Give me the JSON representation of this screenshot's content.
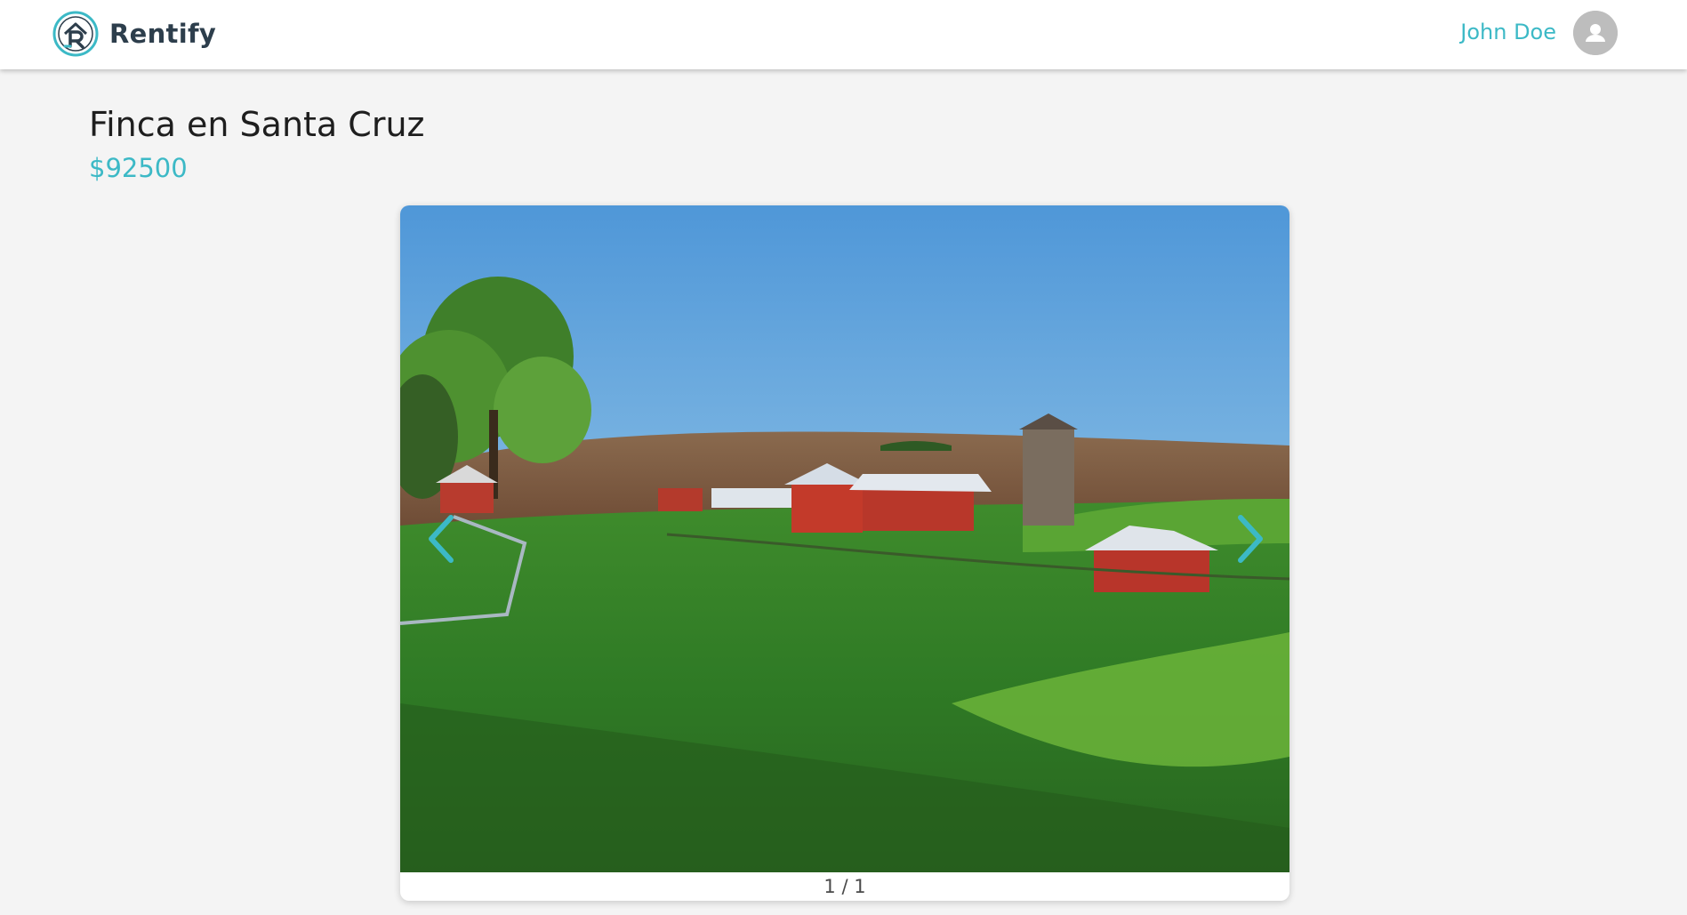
{
  "navbar": {
    "brand": "Rentify",
    "user_name": "John Doe"
  },
  "listing": {
    "title": "Finca en Santa Cruz",
    "price": "$92500"
  },
  "carousel": {
    "counter": "1 / 1",
    "image_alt": "Farm with red barns, silo and green pasture"
  },
  "colors": {
    "accent": "#3cb9c6",
    "brand_dark": "#2d3e4c",
    "background": "#f4f4f4"
  },
  "icons": {
    "logo": "rentify-logo-icon",
    "avatar": "user-avatar-icon",
    "prev": "chevron-left-icon",
    "next": "chevron-right-icon"
  }
}
